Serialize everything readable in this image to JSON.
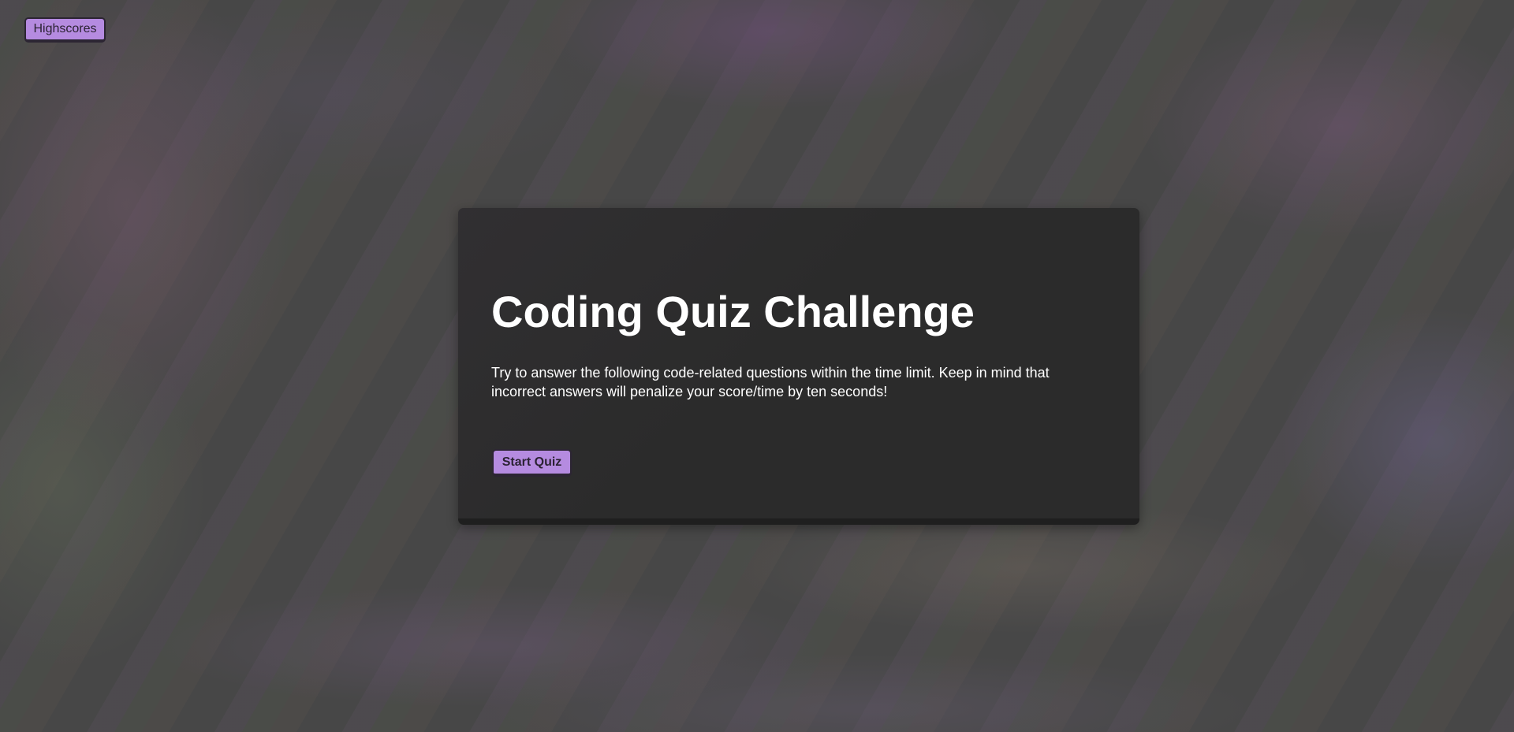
{
  "header": {
    "highscores_label": "Highscores"
  },
  "intro": {
    "title": "Coding Quiz Challenge",
    "description": "Try to answer the following code-related questions within the time limit. Keep in mind that incorrect answers will penalize your score/time by ten seconds!",
    "start_label": "Start Quiz"
  },
  "colors": {
    "accent": "#b58be0",
    "card": "#2b2b2b",
    "background": "#474747"
  }
}
